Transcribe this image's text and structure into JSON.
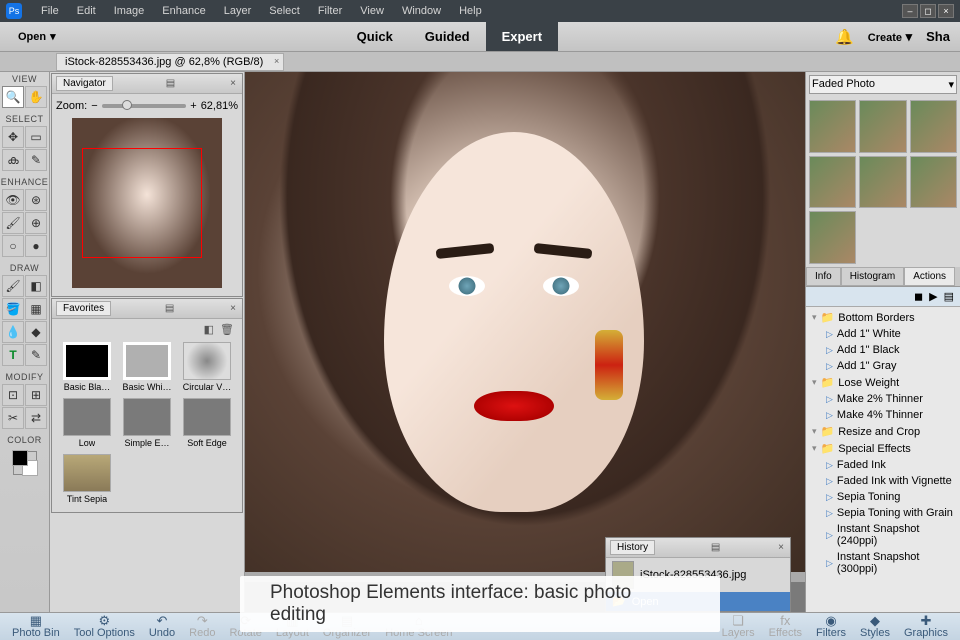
{
  "menu": [
    "File",
    "Edit",
    "Image",
    "Enhance",
    "Layer",
    "Select",
    "Filter",
    "View",
    "Window",
    "Help"
  ],
  "topbar": {
    "open": "Open",
    "quick": "Quick",
    "guided": "Guided",
    "expert": "Expert",
    "create": "Create",
    "share": "Sha"
  },
  "doctab": "iStock-828553436.jpg @ 62,8% (RGB/8)",
  "toolsec": {
    "view": "VIEW",
    "select": "SELECT",
    "enhance": "ENHANCE",
    "draw": "DRAW",
    "modify": "MODIFY",
    "color": "COLOR"
  },
  "nav": {
    "title": "Navigator",
    "zoom_label": "Zoom:",
    "zoom_val": "62,81%"
  },
  "fav": {
    "title": "Favorites",
    "items": [
      "Basic Bla…",
      "Basic Whi…",
      "Circular V…",
      "Low",
      "Simple E…",
      "Soft Edge",
      "Tint Sepia"
    ]
  },
  "preset_sel": "Faded Photo",
  "rtabs": [
    "Info",
    "Histogram",
    "Actions"
  ],
  "actions": [
    {
      "t": "f",
      "n": "Bottom Borders"
    },
    {
      "t": "i",
      "n": "Add 1\" White"
    },
    {
      "t": "i",
      "n": "Add 1\" Black"
    },
    {
      "t": "i",
      "n": "Add 1\" Gray"
    },
    {
      "t": "f",
      "n": "Lose Weight"
    },
    {
      "t": "i",
      "n": "Make 2% Thinner"
    },
    {
      "t": "i",
      "n": "Make 4% Thinner"
    },
    {
      "t": "f",
      "n": "Resize and Crop"
    },
    {
      "t": "f",
      "n": "Special Effects"
    },
    {
      "t": "i",
      "n": "Faded Ink"
    },
    {
      "t": "i",
      "n": "Faded Ink with Vignette"
    },
    {
      "t": "i",
      "n": "Sepia Toning"
    },
    {
      "t": "i",
      "n": "Sepia Toning with Grain"
    },
    {
      "t": "i",
      "n": "Instant Snapshot (240ppi)"
    },
    {
      "t": "i",
      "n": "Instant Snapshot (300ppi)"
    }
  ],
  "history": {
    "title": "History",
    "file": "iStock-828553436.jpg",
    "open": "Open"
  },
  "bottom": [
    "Photo Bin",
    "Tool Options",
    "Undo",
    "Redo",
    "Rotate",
    "Layout",
    "Organizer",
    "Home Screen",
    "Layers",
    "Effects",
    "Filters",
    "Styles",
    "Graphics"
  ],
  "caption": "Photoshop Elements interface: basic photo editing"
}
